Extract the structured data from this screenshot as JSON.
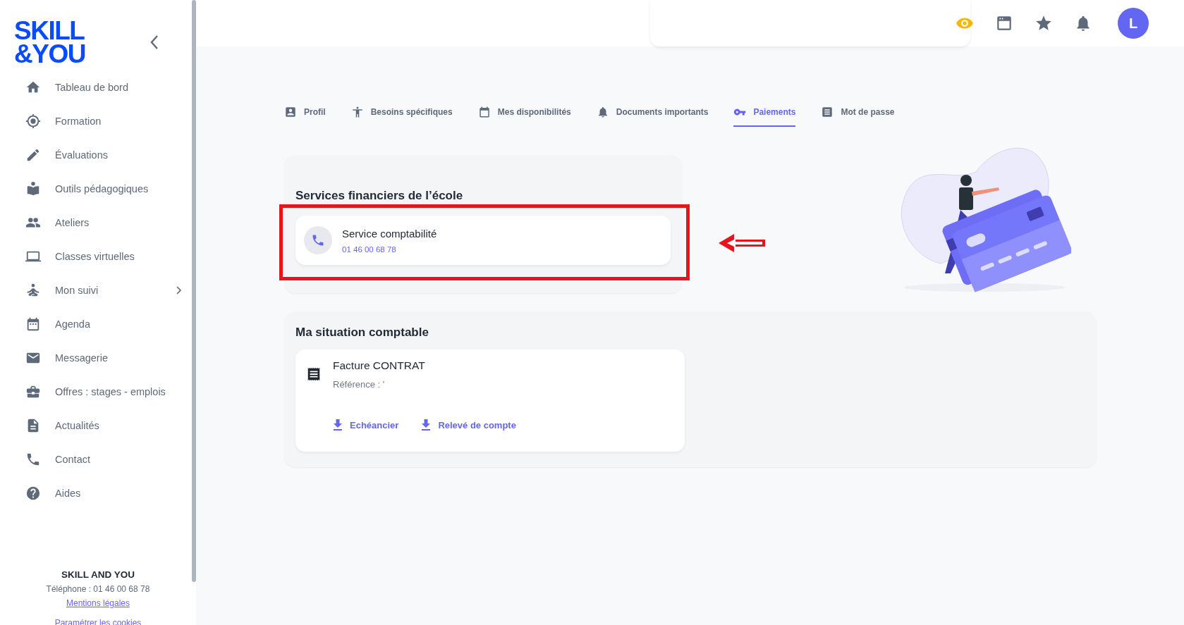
{
  "logo": {
    "line_1": "SKILL",
    "line_2": "&YOU"
  },
  "sidebar": {
    "items": [
      {
        "label": "Tableau de bord",
        "has_submenu": false
      },
      {
        "label": "Formation",
        "has_submenu": false
      },
      {
        "label": "Évaluations",
        "has_submenu": false
      },
      {
        "label": "Outils pédagogiques",
        "has_submenu": false
      },
      {
        "label": "Ateliers",
        "has_submenu": false
      },
      {
        "label": "Classes virtuelles",
        "has_submenu": false
      },
      {
        "label": "Mon suivi",
        "has_submenu": true
      },
      {
        "label": "Agenda",
        "has_submenu": false
      },
      {
        "label": "Messagerie",
        "has_submenu": false
      },
      {
        "label": "Offres : stages - emplois",
        "has_submenu": false
      },
      {
        "label": "Actualités",
        "has_submenu": false
      },
      {
        "label": "Contact",
        "has_submenu": false
      },
      {
        "label": "Aides",
        "has_submenu": false
      }
    ],
    "footer": {
      "company": "SKILL AND YOU",
      "phone": "Téléphone : 01 46 00 68 78",
      "links": [
        "Mentions légales",
        "Paramétrer les cookies"
      ]
    }
  },
  "topbar": {
    "avatar_initial": "L"
  },
  "tabs": [
    {
      "label": "Profil",
      "selected": false
    },
    {
      "label": "Besoins spécifiques",
      "selected": false
    },
    {
      "label": "Mes disponibilités",
      "selected": false
    },
    {
      "label": "Documents importants",
      "selected": false
    },
    {
      "label": "Paiements",
      "selected": true
    },
    {
      "label": "Mot de passe",
      "selected": false
    }
  ],
  "financial_services": {
    "title": "Services financiers de l’école",
    "contacts": [
      {
        "name": "Service comptabilité",
        "phone": "01 46 00 68 78"
      }
    ]
  },
  "account_situation": {
    "title": "Ma situation comptable",
    "invoices": [
      {
        "title": "Facture CONTRAT",
        "reference": "Référence : '",
        "links": [
          "Echéancier",
          "Relevé de compte"
        ]
      }
    ]
  }
}
